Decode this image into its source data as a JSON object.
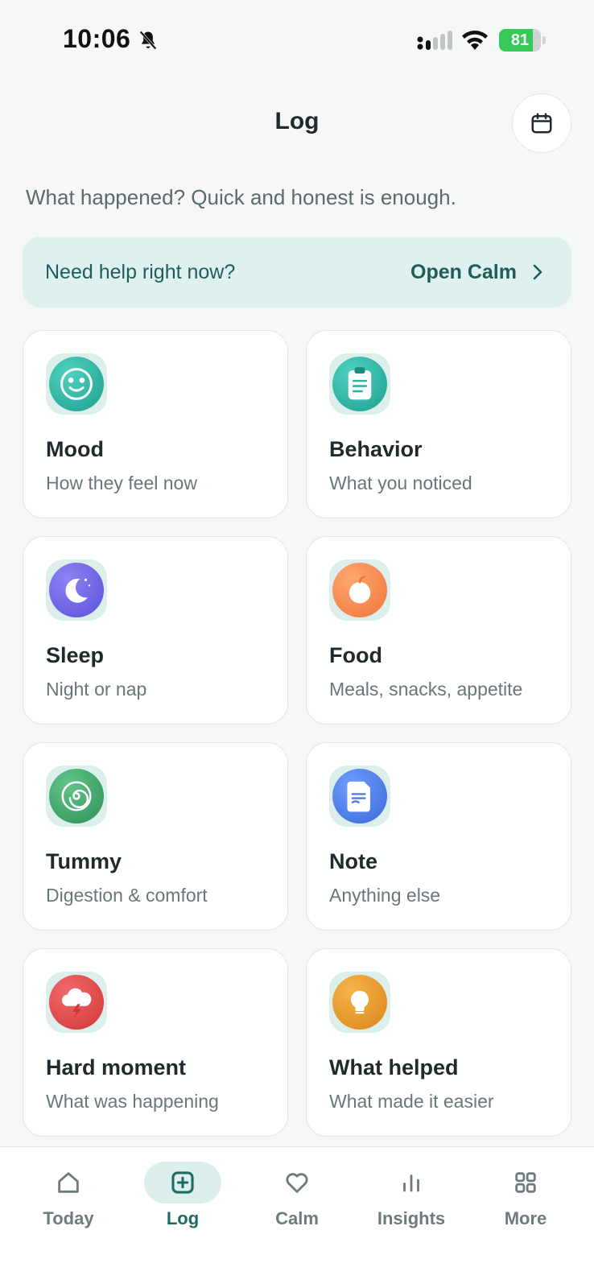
{
  "status_bar": {
    "time": "10:06",
    "battery_level": 81,
    "battery_text": "81"
  },
  "header": {
    "title": "Log",
    "calendar_icon": "calendar-icon"
  },
  "subtitle": "What happened? Quick and honest is enough.",
  "help_banner": {
    "text": "Need help right now?",
    "action": "Open Calm"
  },
  "cards": [
    {
      "title": "Mood",
      "desc": "How they feel now",
      "icon": "smiley-icon",
      "color": "#2bb3a3"
    },
    {
      "title": "Behavior",
      "desc": "What you noticed",
      "icon": "clipboard-icon",
      "color": "#2bb3a3"
    },
    {
      "title": "Sleep",
      "desc": "Night or nap",
      "icon": "moon-icon",
      "color": "#6e62e6"
    },
    {
      "title": "Food",
      "desc": "Meals, snacks, appetite",
      "icon": "apple-icon",
      "color": "#f2874f"
    },
    {
      "title": "Tummy",
      "desc": "Digestion & comfort",
      "icon": "spiral-icon",
      "color": "#3fa66a"
    },
    {
      "title": "Note",
      "desc": "Anything else",
      "icon": "document-icon",
      "color": "#4c7ee6"
    },
    {
      "title": "Hard moment",
      "desc": "What was happening",
      "icon": "storm-cloud-icon",
      "color": "#e54848"
    },
    {
      "title": "What helped",
      "desc": "What made it easier",
      "icon": "lightbulb-icon",
      "color": "#e89b2a"
    }
  ],
  "nav": [
    {
      "label": "Today",
      "icon": "home-icon"
    },
    {
      "label": "Log",
      "icon": "plus-square-icon",
      "active": true
    },
    {
      "label": "Calm",
      "icon": "heart-icon"
    },
    {
      "label": "Insights",
      "icon": "bar-chart-icon"
    },
    {
      "label": "More",
      "icon": "grid-icon"
    }
  ],
  "colors": {
    "accent": "#1e6b66",
    "banner_bg": "#dff1ef",
    "background": "#f6f8f8"
  }
}
